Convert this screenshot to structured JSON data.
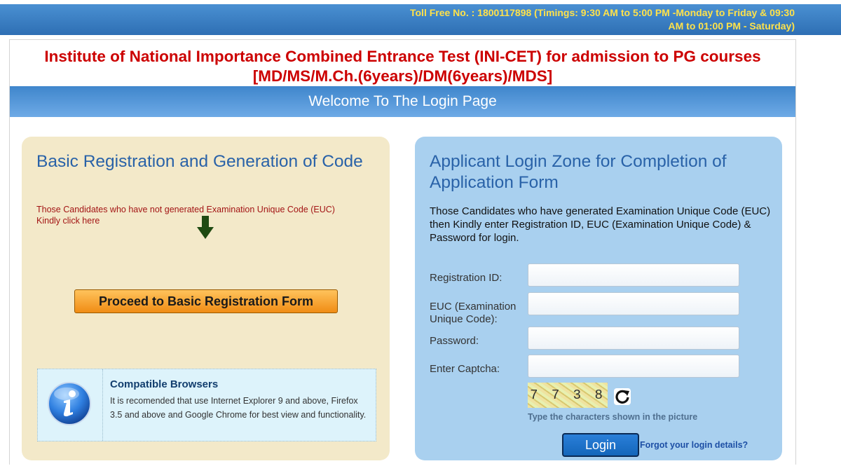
{
  "topbar": {
    "tollfree_line1": "Toll Free No. : 1800117898 (Timings: 9:30 AM to 5:00 PM -Monday to Friday & 09:30",
    "tollfree_line2": "AM to 01:00 PM - Saturday)"
  },
  "header": {
    "title_line1": "Institute of National Importance Combined Entrance Test (INI-CET) for admission to PG courses",
    "title_line2": "[MD/MS/M.Ch.(6years)/DM(6years)/MDS]",
    "welcome": "Welcome To The Login Page"
  },
  "left_panel": {
    "title": "Basic Registration and Generation of Code",
    "note_line1": "Those Candidates who have not generated Examination Unique Code (EUC)",
    "note_line2": "Kindly click here",
    "arrow_icon": "down-arrow-icon",
    "proceed_button": "Proceed to Basic Registration Form",
    "compat": {
      "icon": "info-icon",
      "title": "Compatible Browsers",
      "text": "It is recomended that use Internet Explorer 9 and above, Firefox 3.5 and above and Google Chrome for best view and functionality."
    }
  },
  "right_panel": {
    "title": "Applicant Login Zone for Completion of Application Form",
    "note": "Those Candidates who have generated Examination Unique Code (EUC) then Kindly enter Registration ID, EUC (Examination Unique Code) & Password for login.",
    "labels": {
      "registration_id": "Registration ID:",
      "euc": "EUC (Examination Unique Code):",
      "password": "Password:",
      "captcha": "Enter Captcha:"
    },
    "captcha_text": "7 7 3 8",
    "captcha_hint": "Type the characters shown in the picture",
    "login_button": "Login",
    "forgot_link": "Forgot your login details?"
  },
  "colors": {
    "brand_blue": "#2e6fb4",
    "title_red": "#cc0000",
    "left_panel_bg": "#f3e9c9",
    "right_panel_bg": "#a9d0ef",
    "toll_yellow": "#ffe24a"
  }
}
